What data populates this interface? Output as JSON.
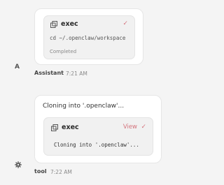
{
  "messages": [
    {
      "tool": {
        "name": "exec",
        "command": "cd ~/.openclaw/workspace",
        "status": "Completed",
        "check": "✓"
      },
      "avatar": "A",
      "sender": "Assistant",
      "time": "7:21 AM"
    },
    {
      "text": "Cloning into '.openclaw'...",
      "tool": {
        "name": "exec",
        "view_label": "View",
        "check": "✓",
        "output": "Cloning into '.openclaw'..."
      },
      "avatar_icon": "gear-icon",
      "sender": "tool",
      "time": "7:22 AM"
    }
  ],
  "colors": {
    "background": "#f4f4f4",
    "card": "#ffffff",
    "tool_box": "#f1f1f1",
    "accent": "#d4737d"
  }
}
